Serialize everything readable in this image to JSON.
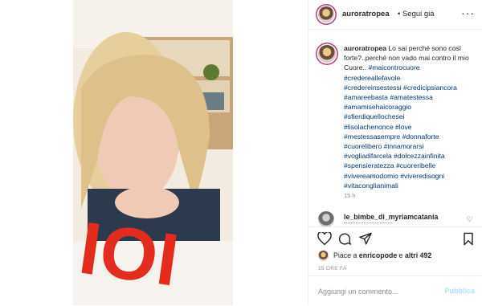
{
  "post": {
    "username": "auroratropea",
    "follow_label": "Segui già",
    "caption_intro": "Lo sai perché sono così forte?..perché non vado mai contro il mio Cuore..",
    "hashtags": [
      "#maicontrocuore",
      "#credereallefavole",
      "#credereinsestessi #credicipsiancora",
      "#amareebasta #amatestessa",
      "#amamisehaicoraggio",
      "#sfierdiquellochesei",
      "#lisolachenonce #love",
      "#mestessasempre #donnaforte",
      "#cuorelibero #innamorarsi",
      "#vogliadifarcela #dolcezzainfinita",
      "#spensieratezza #cuoreribelle",
      "#vivereamodomio #viveredisogni",
      "#vitaconglianimali"
    ],
    "caption_time": "15 h"
  },
  "comment": {
    "username": "le_bimbe_di_myriamcatania"
  },
  "likes": {
    "prefix": "Piace a",
    "user": "enricopode",
    "middle": "e",
    "others": "altri 492"
  },
  "timestamp": "15 ORE FA",
  "add_comment": {
    "placeholder": "Aggiungi un commento...",
    "publish": "Pubblica"
  },
  "photo": {
    "letters": "IOI"
  },
  "colors": {
    "link": "#00376b",
    "publish": "#b2dffc",
    "red_letters": "#e32b1e"
  }
}
